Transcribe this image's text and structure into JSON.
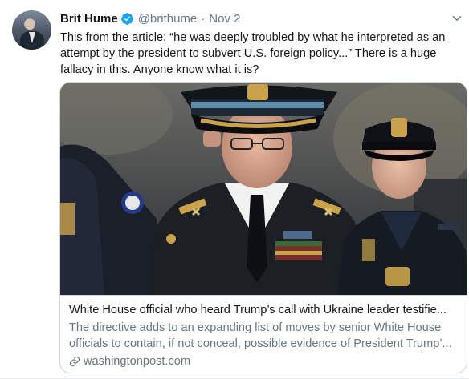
{
  "tweet": {
    "author_name": "Brit Hume",
    "handle": "@brithume",
    "separator": "·",
    "date": "Nov 2",
    "verified_icon": "verified-badge-icon",
    "text_lines": [
      "This from the article: “he was deeply troubled by what he interpreted as an",
      "attempt by the president to subvert U.S. foreign policy...” There is a huge",
      "fallacy in this. Anyone know what it is?"
    ]
  },
  "card": {
    "title": "White House official who heard Trump’s call with Ukraine leader testifie...",
    "description_lines": [
      "The directive adds to an expanding list of moves by senior White House",
      "officials to contain, if not conceal, possible evidence of President Trump’..."
    ],
    "domain": "washingtonpost.com",
    "domain_icon": "link-icon"
  },
  "colors": {
    "verified_blue": "#1da1f2",
    "secondary_text": "#657786",
    "primary_text": "#14171a",
    "border": "#ccd6dd"
  }
}
